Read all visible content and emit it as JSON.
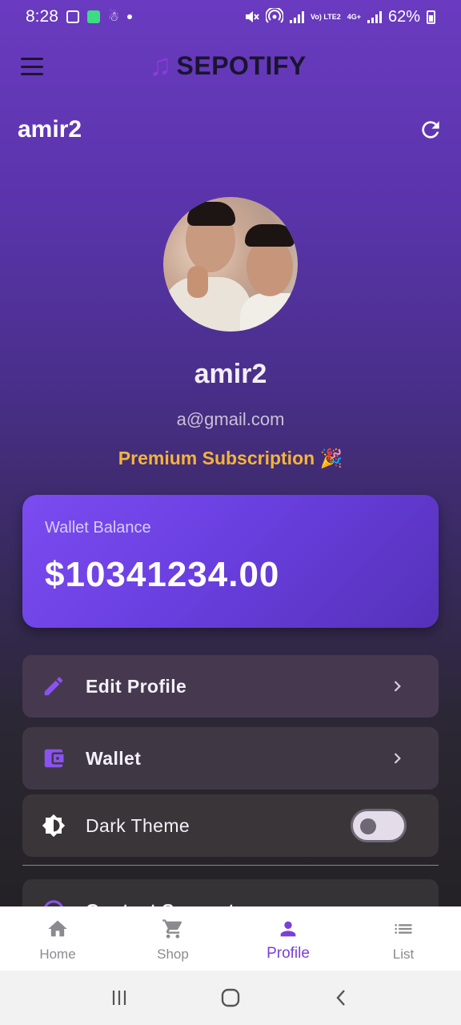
{
  "status_bar": {
    "time": "8:28",
    "battery": "62%",
    "network": "4G+",
    "volte": "Vo) LTE2"
  },
  "app_bar": {
    "brand": "SEPOTIFY",
    "brand_icon": "music-note-icon",
    "brand_color": "#8a3bd8"
  },
  "header": {
    "username": "amir2"
  },
  "profile": {
    "name": "amir2",
    "email": "a@gmail.com",
    "subscription": "Premium Subscription 🎉",
    "subscription_color": "#f5b43a"
  },
  "wallet": {
    "label": "Wallet Balance",
    "amount": "$10341234.00"
  },
  "options": {
    "edit_profile": "Edit Profile",
    "wallet": "Wallet",
    "dark_theme": "Dark Theme",
    "dark_theme_on": false,
    "contact_support": "Contact Support"
  },
  "bottom_nav": {
    "items": [
      {
        "label": "Home",
        "icon": "home-icon"
      },
      {
        "label": "Shop",
        "icon": "cart-icon"
      },
      {
        "label": "Profile",
        "icon": "person-icon",
        "active": true
      },
      {
        "label": "List",
        "icon": "list-icon"
      }
    ],
    "active_color": "#7a3fd6"
  }
}
